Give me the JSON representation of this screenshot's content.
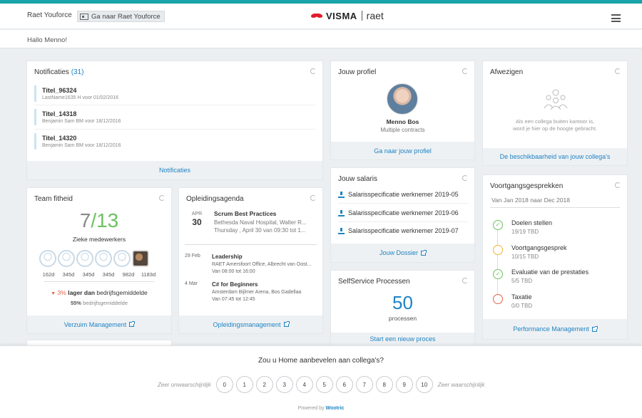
{
  "header": {
    "brand": "Raet Youforce",
    "goto_label": "Ga naar Raet Youforce",
    "logo_visma": "VISMA",
    "logo_raet": "raet"
  },
  "greeting": "Hallo Menno!",
  "notifications": {
    "title": "Notificaties",
    "count": "(31)",
    "items": [
      {
        "title": "Titel_96324",
        "sub": "LastName1635 H voor 01/02/2016"
      },
      {
        "title": "Titel_14318",
        "sub": "Benjamin Sam BM voor 18/12/2016"
      },
      {
        "title": "Titel_14320",
        "sub": "Benjamin Sam BM voor 18/12/2016"
      }
    ],
    "footer": "Notificaties"
  },
  "profile": {
    "title": "Jouw profiel",
    "name": "Menno Bos",
    "sub": "Multiple contracts",
    "footer": "Ga naar jouw profiel"
  },
  "absence": {
    "title": "Afwezigen",
    "text": "Als een collega buiten kantoor is, word je hier op de hoogte gebracht.",
    "footer": "De beschikbaarheid van jouw collega's"
  },
  "team": {
    "title": "Team fitheid",
    "big_left": "7",
    "big_slash": "/",
    "big_right": "13",
    "label": "Zieke medewerkers",
    "days": [
      "162d",
      "345d",
      "345d",
      "345d",
      "982d",
      "1183d"
    ],
    "compare_value": "3%",
    "compare_bold": "lager dan",
    "compare_rest": "bedrijfsgemiddelde",
    "avg_value": "55%",
    "avg_rest": "bedrijfsgemiddelde",
    "footer": "Verzuim Management"
  },
  "training": {
    "title": "Opleidingsagenda",
    "featured": {
      "month": "APR",
      "day": "30",
      "title": "Scrum Best Practices",
      "location": "Bethesda Naval Hospital, Walter R...",
      "time": "Thursday , April 30 van 09:30 tot 1..."
    },
    "events": [
      {
        "date": "29 Feb",
        "title": "Leadership",
        "location": "RAET Amersfoort Office, Albrecht van Oost...",
        "time": "Van 08:00 tot 16:00"
      },
      {
        "date": "4 Mar",
        "title": "C# for Beginners",
        "location": "Amsterdam Bijlmer Arena, Bos Gadellaa",
        "time": "Van 07:45 tot 12:45"
      }
    ],
    "footer": "Opleidingsmanagement"
  },
  "salary": {
    "title": "Jouw salaris",
    "items": [
      "Salarisspecificatie werknemer 2019-05",
      "Salarisspecificatie werknemer 2019-06",
      "Salarisspecificatie werknemer 2019-07"
    ],
    "footer": "Jouw Dossier"
  },
  "selfservice": {
    "title": "SelfService Processen",
    "count": "50",
    "label": "processen",
    "footer": "Start een nieuw proces"
  },
  "progress": {
    "title": "Voortgangsgesprekken",
    "period": "Van Jan 2018 naar Dec 2018",
    "items": [
      {
        "title": "Doelen stellen",
        "sub": "19/19 TBD",
        "status": "done"
      },
      {
        "title": "Voortgangsgesprek",
        "sub": "10/15 TBD",
        "status": "partial"
      },
      {
        "title": "Evaluatie van de prestaties",
        "sub": "5/5 TBD",
        "status": "done"
      },
      {
        "title": "Taxatie",
        "sub": "0/0 TBD",
        "status": "none"
      }
    ],
    "footer": "Performance Management"
  },
  "survey": {
    "question": "Zou u Home aanbevelen aan collega's?",
    "low_label": "Zeer onwaarschijnlijk",
    "high_label": "Zeer waarschijnlijk",
    "options": [
      "0",
      "1",
      "2",
      "3",
      "4",
      "5",
      "6",
      "7",
      "8",
      "9",
      "10"
    ],
    "powered_prefix": "Powered by",
    "powered_brand": "Wootric"
  },
  "colors": {
    "accent": "#1f83c4",
    "teal": "#1aa3a8",
    "green": "#6cc25f",
    "amber": "#f2b233",
    "red": "#e8614a"
  }
}
